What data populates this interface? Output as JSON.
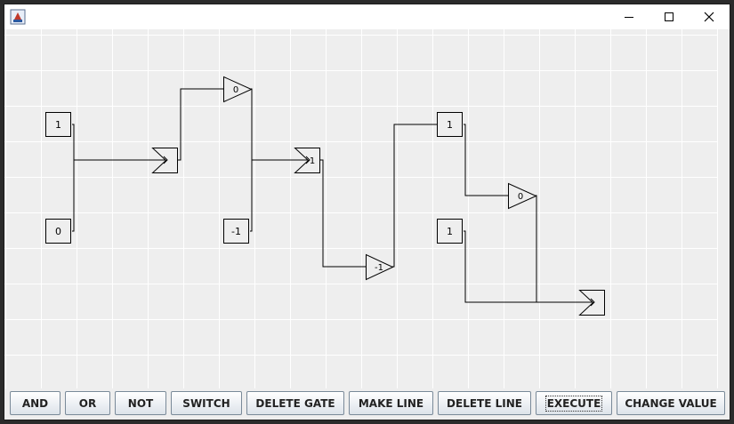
{
  "window": {
    "title": "",
    "controls": [
      "minimize-icon",
      "maximize-icon",
      "close-icon"
    ]
  },
  "canvas": {
    "grid": true,
    "switches": [
      {
        "value": "1"
      },
      {
        "value": "0"
      },
      {
        "value": "-1"
      },
      {
        "value": "1"
      },
      {
        "value": "1"
      }
    ],
    "gates": [
      {
        "type": "NOT",
        "value": "0"
      },
      {
        "type": "OR",
        "value": ""
      },
      {
        "type": "OR",
        "value": "1"
      },
      {
        "type": "NOT",
        "value": "-1"
      },
      {
        "type": "NOT",
        "value": "0"
      },
      {
        "type": "OR",
        "value": ""
      }
    ]
  },
  "toolbar": {
    "buttons": [
      {
        "label": "AND"
      },
      {
        "label": "OR"
      },
      {
        "label": "NOT"
      },
      {
        "label": "SWITCH"
      },
      {
        "label": "DELETE GATE"
      },
      {
        "label": "MAKE LINE"
      },
      {
        "label": "DELETE LINE"
      },
      {
        "label": "EXECUTE"
      },
      {
        "label": "CHANGE VALUE"
      }
    ]
  }
}
